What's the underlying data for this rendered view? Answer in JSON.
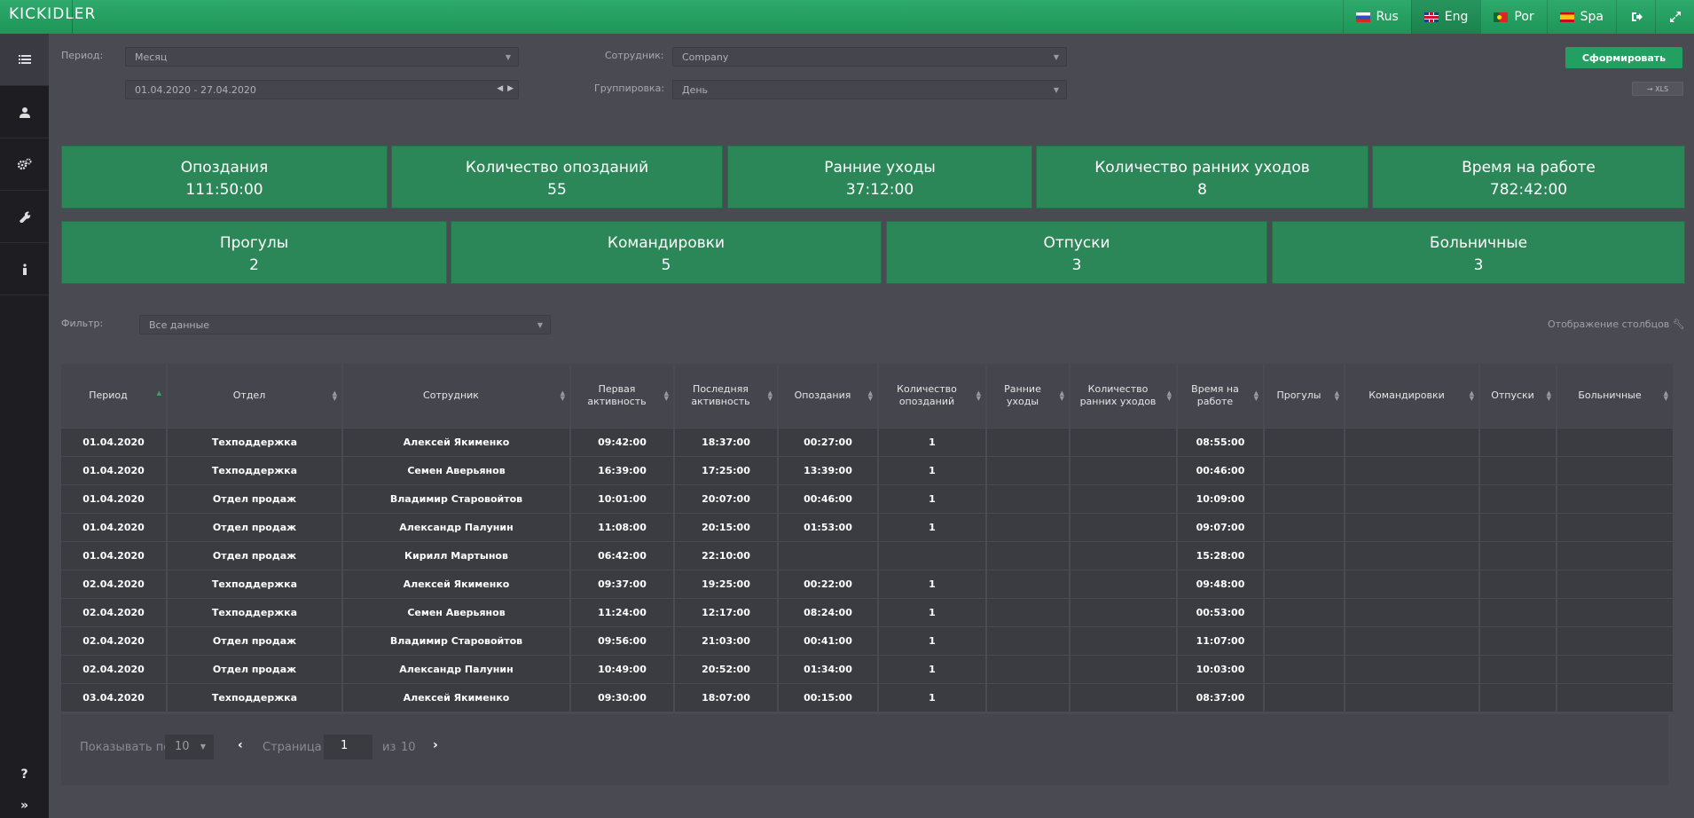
{
  "brand": {
    "logo": "KICKIDLER"
  },
  "top_nav": {
    "languages": [
      {
        "code": "ru",
        "label": "Rus"
      },
      {
        "code": "en",
        "label": "Eng"
      },
      {
        "code": "pt",
        "label": "Por"
      },
      {
        "code": "es",
        "label": "Spa"
      }
    ],
    "active_language": "Eng",
    "exit_icon": "sign-out-icon",
    "expand_icon": "expand-icon"
  },
  "sidebar": {
    "items": [
      {
        "icon": "list-icon"
      },
      {
        "icon": "user-icon"
      },
      {
        "icon": "gears-icon"
      },
      {
        "icon": "wrench-icon"
      },
      {
        "icon": "info-icon"
      }
    ],
    "help": "?",
    "collapse": "»"
  },
  "filters": {
    "period_label": "Период:",
    "period_value": "Месяц",
    "date_range": "01.04.2020 - 27.04.2020",
    "employee_label": "Сотрудник:",
    "employee_value": "Company",
    "grouping_label": "Группировка:",
    "grouping_value": "День",
    "generate_button": "Сформировать",
    "export_button": "→ XLS"
  },
  "stats_row1": [
    {
      "title": "Опоздания",
      "value": "111:50:00"
    },
    {
      "title": "Количество опозданий",
      "value": "55"
    },
    {
      "title": "Ранние уходы",
      "value": "37:12:00"
    },
    {
      "title": "Количество ранних уходов",
      "value": "8"
    },
    {
      "title": "Время на работе",
      "value": "782:42:00"
    }
  ],
  "stats_row2": [
    {
      "title": "Прогулы",
      "value": "2"
    },
    {
      "title": "Командировки",
      "value": "5"
    },
    {
      "title": "Отпуски",
      "value": "3"
    },
    {
      "title": "Больничные",
      "value": "3"
    }
  ],
  "table_filter": {
    "label": "Фильтр:",
    "value": "Все данные",
    "columns_link": "Отображение столбцов"
  },
  "table": {
    "headers": [
      "Период",
      "Отдел",
      "Сотрудник",
      "Первая активность",
      "Последняя активность",
      "Опоздания",
      "Количество опозданий",
      "Ранние уходы",
      "Количество ранних уходов",
      "Время на работе",
      "Прогулы",
      "Командировки",
      "Отпуски",
      "Больничные"
    ],
    "rows": [
      [
        "01.04.2020",
        "Техподдержка",
        "Алексей Якименко",
        "09:42:00",
        "18:37:00",
        "00:27:00",
        "1",
        "",
        "",
        "08:55:00",
        "",
        "",
        "",
        ""
      ],
      [
        "01.04.2020",
        "Техподдержка",
        "Семен Аверьянов",
        "16:39:00",
        "17:25:00",
        "13:39:00",
        "1",
        "",
        "",
        "00:46:00",
        "",
        "",
        "",
        ""
      ],
      [
        "01.04.2020",
        "Отдел продаж",
        "Владимир Старовойтов",
        "10:01:00",
        "20:07:00",
        "00:46:00",
        "1",
        "",
        "",
        "10:09:00",
        "",
        "",
        "",
        ""
      ],
      [
        "01.04.2020",
        "Отдел продаж",
        "Александр Палунин",
        "11:08:00",
        "20:15:00",
        "01:53:00",
        "1",
        "",
        "",
        "09:07:00",
        "",
        "",
        "",
        ""
      ],
      [
        "01.04.2020",
        "Отдел продаж",
        "Кирилл Мартынов",
        "06:42:00",
        "22:10:00",
        "",
        "",
        "",
        "",
        "15:28:00",
        "",
        "",
        "",
        ""
      ],
      [
        "02.04.2020",
        "Техподдержка",
        "Алексей Якименко",
        "09:37:00",
        "19:25:00",
        "00:22:00",
        "1",
        "",
        "",
        "09:48:00",
        "",
        "",
        "",
        ""
      ],
      [
        "02.04.2020",
        "Техподдержка",
        "Семен Аверьянов",
        "11:24:00",
        "12:17:00",
        "08:24:00",
        "1",
        "",
        "",
        "00:53:00",
        "",
        "",
        "",
        ""
      ],
      [
        "02.04.2020",
        "Отдел продаж",
        "Владимир Старовойтов",
        "09:56:00",
        "21:03:00",
        "00:41:00",
        "1",
        "",
        "",
        "11:07:00",
        "",
        "",
        "",
        ""
      ],
      [
        "02.04.2020",
        "Отдел продаж",
        "Александр Палунин",
        "10:49:00",
        "20:52:00",
        "01:34:00",
        "1",
        "",
        "",
        "10:03:00",
        "",
        "",
        "",
        ""
      ],
      [
        "03.04.2020",
        "Техподдержка",
        "Алексей Якименко",
        "09:30:00",
        "18:07:00",
        "00:15:00",
        "1",
        "",
        "",
        "08:37:00",
        "",
        "",
        "",
        ""
      ]
    ]
  },
  "pagination": {
    "show_label": "Показывать по",
    "page_size": "10",
    "prev": "‹",
    "page_label": "Страница",
    "current_page": "1",
    "of_label": "из",
    "total_pages": "10",
    "next": "›"
  }
}
